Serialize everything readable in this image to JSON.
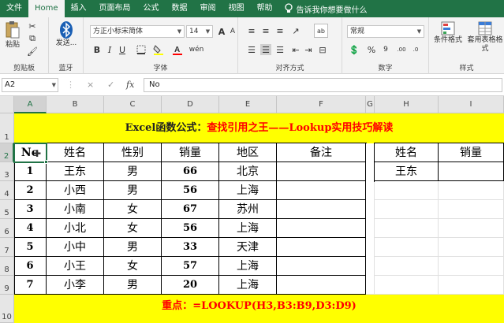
{
  "menu": {
    "tabs": [
      "文件",
      "Home",
      "插入",
      "页面布局",
      "公式",
      "数据",
      "审阅",
      "视图",
      "帮助"
    ],
    "active": "Home",
    "tell_me": "告诉我你想要做什么"
  },
  "ribbon": {
    "clipboard": {
      "paste": "粘贴",
      "label": "剪贴板"
    },
    "bluetooth": {
      "send": "发送...",
      "label": "蓝牙"
    },
    "font": {
      "name": "方正小标宋简体",
      "size": "14",
      "bold": "B",
      "italic": "I",
      "underline": "U",
      "grow": "A",
      "shrink": "A",
      "label": "字体"
    },
    "alignment": {
      "label": "对齐方式"
    },
    "number": {
      "format": "常规",
      "percent": "%",
      "comma": "9",
      "label": "数字"
    },
    "styles": {
      "conditional": "条件格式",
      "table": "套用表格格式",
      "label": "样式"
    }
  },
  "formula_bar": {
    "cell_ref": "A2",
    "cancel": "×",
    "enter": "✓",
    "fx": "fx",
    "value": "No"
  },
  "columns": [
    "A",
    "B",
    "C",
    "D",
    "E",
    "F",
    "G",
    "H",
    "I"
  ],
  "rows": [
    "1",
    "2",
    "3",
    "4",
    "5",
    "6",
    "7",
    "8",
    "9",
    "10"
  ],
  "title_row": {
    "prefix": "Excel函数公式：",
    "highlight": "查找引用之王——Lookup实用技巧解读"
  },
  "table": {
    "headers": [
      "No",
      "姓名",
      "性别",
      "销量",
      "地区",
      "备注"
    ],
    "rows": [
      [
        "1",
        "王东",
        "男",
        "66",
        "北京",
        ""
      ],
      [
        "2",
        "小西",
        "男",
        "56",
        "上海",
        ""
      ],
      [
        "3",
        "小南",
        "女",
        "67",
        "苏州",
        ""
      ],
      [
        "4",
        "小北",
        "女",
        "56",
        "上海",
        ""
      ],
      [
        "5",
        "小中",
        "男",
        "33",
        "天津",
        ""
      ],
      [
        "6",
        "小王",
        "女",
        "57",
        "上海",
        ""
      ],
      [
        "7",
        "小李",
        "男",
        "20",
        "上海",
        ""
      ]
    ]
  },
  "lookup_table": {
    "headers": [
      "姓名",
      "销量"
    ],
    "rows": [
      [
        "王东",
        ""
      ]
    ]
  },
  "footer_row": {
    "prefix": "重点：",
    "formula": "=LOOKUP(H3,B3:B9,D3:D9)"
  },
  "colors": {
    "excel_green": "#217346",
    "band_yellow": "#ffff00",
    "highlight_red": "#ff0000"
  }
}
